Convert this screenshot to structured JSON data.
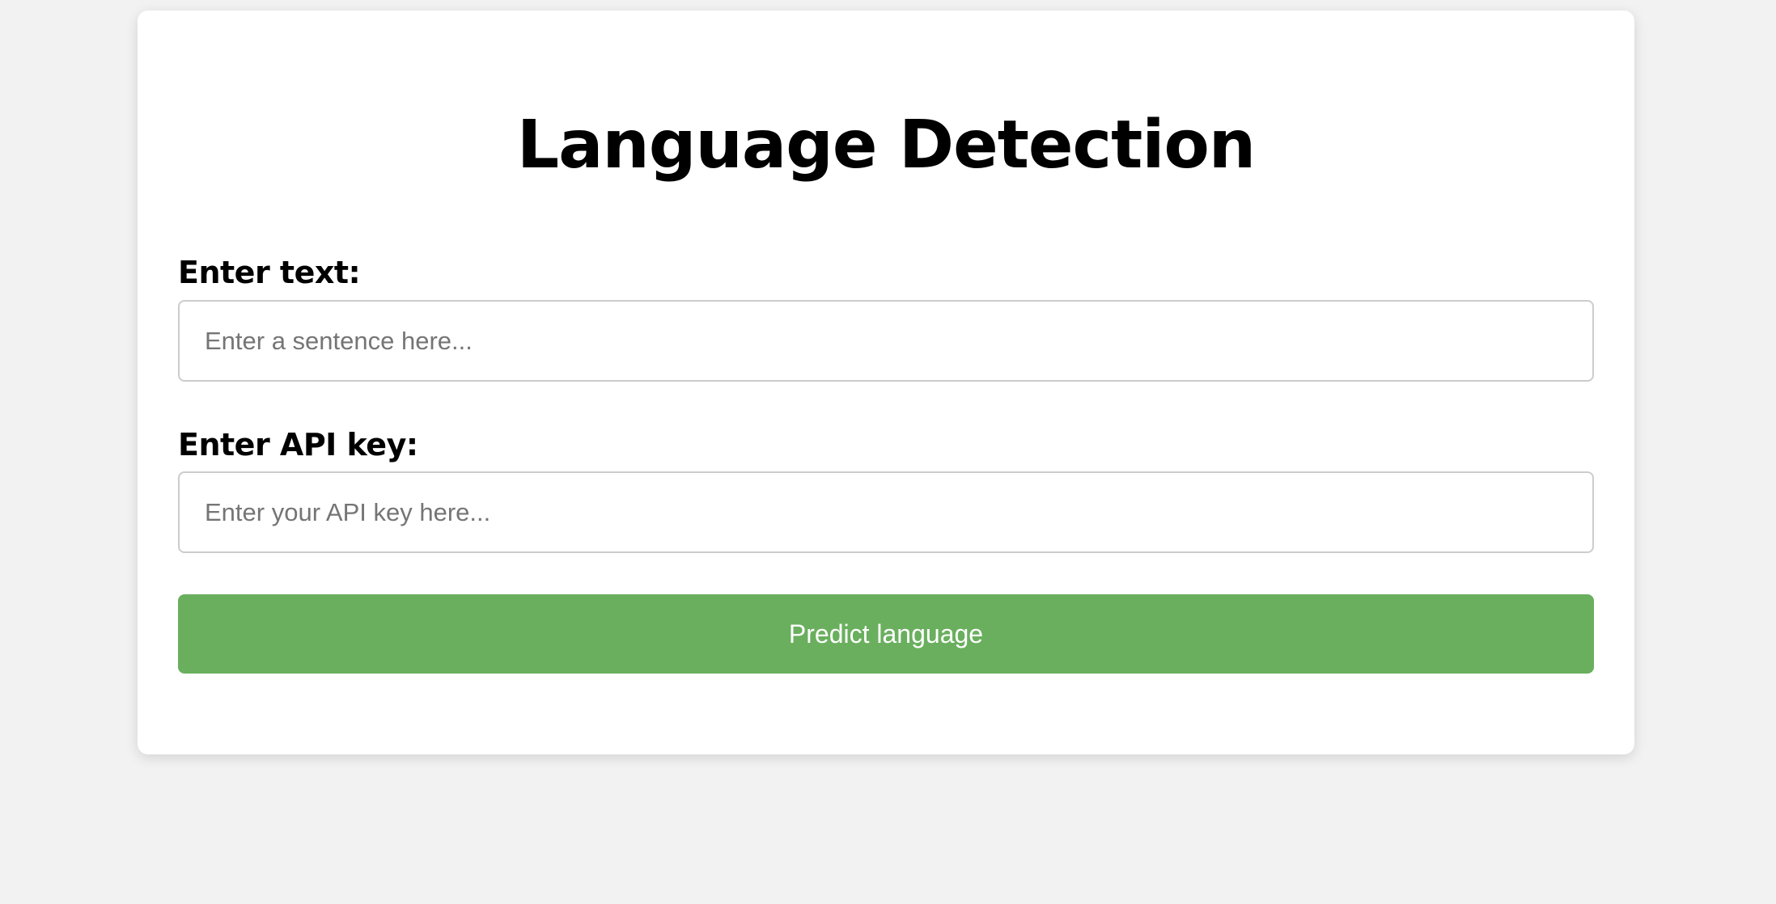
{
  "page": {
    "title": "Language Detection"
  },
  "form": {
    "text_label": "Enter text:",
    "text_placeholder": "Enter a sentence here...",
    "text_value": "",
    "api_label": "Enter API key:",
    "api_placeholder": "Enter your API key here...",
    "api_value": "",
    "submit_label": "Predict language"
  },
  "colors": {
    "background": "#f2f2f2",
    "card": "#ffffff",
    "button": "#6aaf5e",
    "button_text": "#ffffff",
    "input_border": "#cccccc"
  }
}
